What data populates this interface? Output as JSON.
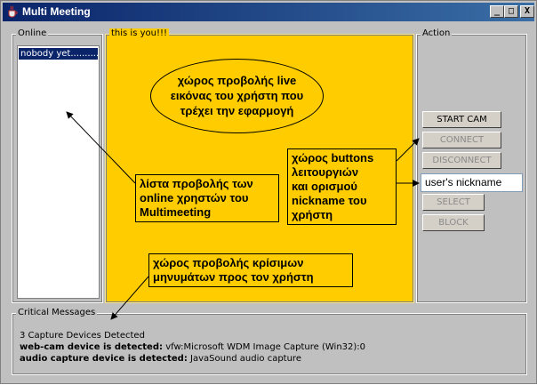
{
  "window": {
    "title": "Multi Meeting"
  },
  "titlebar_buttons": {
    "minimize": "_",
    "maximize": "□",
    "close": "X"
  },
  "online": {
    "title": "Online",
    "items": [
      "nobody yet.........."
    ]
  },
  "video": {
    "title": "this is you!!!"
  },
  "action": {
    "title": "Action",
    "buttons": [
      {
        "label": "START CAM",
        "enabled": true
      },
      {
        "label": "CONNECT",
        "enabled": false
      },
      {
        "label": "DISCONNECT",
        "enabled": false
      },
      {
        "label": "SELECT",
        "enabled": false
      },
      {
        "label": "BLOCK",
        "enabled": false
      }
    ],
    "nickname_value": "user's nickname"
  },
  "critical": {
    "title": "Critical Messages",
    "line1": "3 Capture Devices Detected",
    "line2_label": "web-cam device is detected:",
    "line2_value": "vfw:Microsoft WDM Image Capture (Win32):0",
    "line3_label": "audio capture device is detected:",
    "line3_value": "JavaSound audio capture"
  },
  "annotations": {
    "video_area": [
      "χώρος προβολής live",
      "εικόνας του χρήστη που",
      "τρέχει την εφαρμογή"
    ],
    "online_list": [
      "λίστα προβολής των",
      "online χρηστών του",
      "Multimeeting"
    ],
    "buttons_area": [
      "χώρος buttons",
      "λειτουργιών",
      "και ορισμού",
      "nickname του",
      "χρήστη"
    ],
    "messages_area": [
      "χώρος προβολής κρίσιμων",
      "μηνυμάτων προς τον χρήστη"
    ]
  },
  "colors": {
    "title_gradient_start": "#0a246a",
    "panel_yellow": "#ffcc00",
    "window_gray": "#c0c0c0",
    "selection_blue": "#0a246a"
  },
  "icons": [
    "java-cup-icon",
    "minimize-icon",
    "maximize-icon",
    "close-icon"
  ]
}
